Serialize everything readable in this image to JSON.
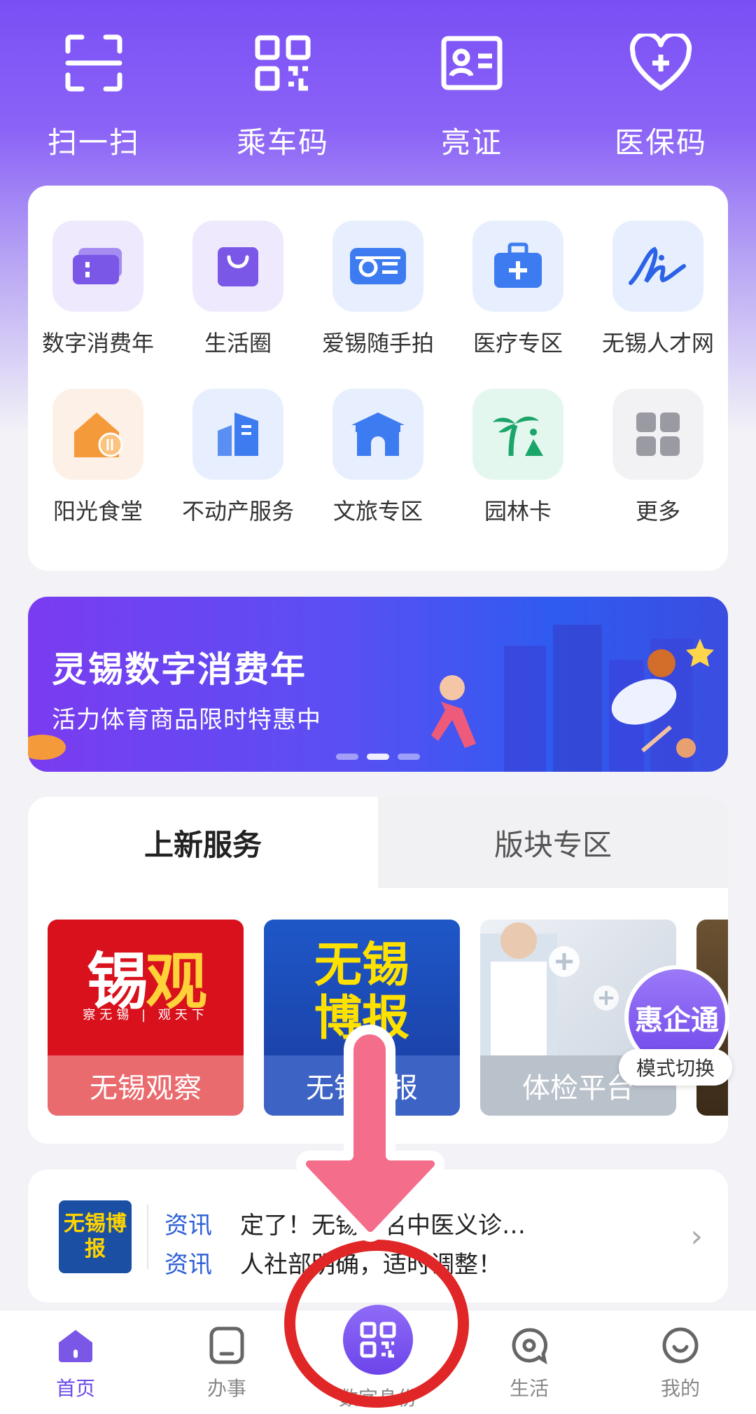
{
  "quick_actions": [
    {
      "label": "扫一扫",
      "icon": "scan-icon"
    },
    {
      "label": "乘车码",
      "icon": "qr-code-icon"
    },
    {
      "label": "亮证",
      "icon": "id-card-icon"
    },
    {
      "label": "医保码",
      "icon": "heart-plus-icon"
    }
  ],
  "services": [
    {
      "label": "数字消费年",
      "icon": "ticket-icon"
    },
    {
      "label": "生活圈",
      "icon": "shopping-bag-icon"
    },
    {
      "label": "爱锡随手拍",
      "icon": "camera-card-icon"
    },
    {
      "label": "医疗专区",
      "icon": "medical-kit-icon"
    },
    {
      "label": "无锡人才网",
      "icon": "signature-icon"
    },
    {
      "label": "阳光食堂",
      "icon": "house-fork-icon"
    },
    {
      "label": "不动产服务",
      "icon": "building-icon"
    },
    {
      "label": "文旅专区",
      "icon": "pavilion-icon"
    },
    {
      "label": "园林卡",
      "icon": "palm-tree-icon"
    },
    {
      "label": "更多",
      "icon": "more-grid-icon"
    }
  ],
  "banner": {
    "title": "灵锡数字消费年",
    "subtitle": "活力体育商品限时特惠中",
    "active_dot": 1
  },
  "tabs": [
    {
      "label": "上新服务",
      "active": true
    },
    {
      "label": "版块专区",
      "active": false
    }
  ],
  "new_services": [
    {
      "label": "无锡观察",
      "art_text": "锡观",
      "art_sub": "察无锡 | 观天下"
    },
    {
      "label": "无锡博报",
      "art_text": "无锡博报"
    },
    {
      "label": "体检平台"
    }
  ],
  "float": {
    "label": "惠企通",
    "switch_label": "模式切换"
  },
  "news": {
    "logo_text": "无锡博报",
    "items": [
      {
        "tag": "资讯",
        "text": "定了！无锡市名中医义诊…"
      },
      {
        "tag": "资讯",
        "text": "人社部明确，适时调整！"
      }
    ]
  },
  "bottom_nav": [
    {
      "label": "首页",
      "icon": "home-icon",
      "active": true
    },
    {
      "label": "办事",
      "icon": "tasks-icon",
      "active": false
    },
    {
      "label": "数字身份",
      "icon": "qr-code-icon",
      "active": false
    },
    {
      "label": "生活",
      "icon": "chat-location-icon",
      "active": false
    },
    {
      "label": "我的",
      "icon": "smile-icon",
      "active": false
    }
  ],
  "colors": {
    "brand": "#7a4ff5",
    "annotation_arrow": "#f46d8b",
    "annotation_circle": "#e02626"
  }
}
